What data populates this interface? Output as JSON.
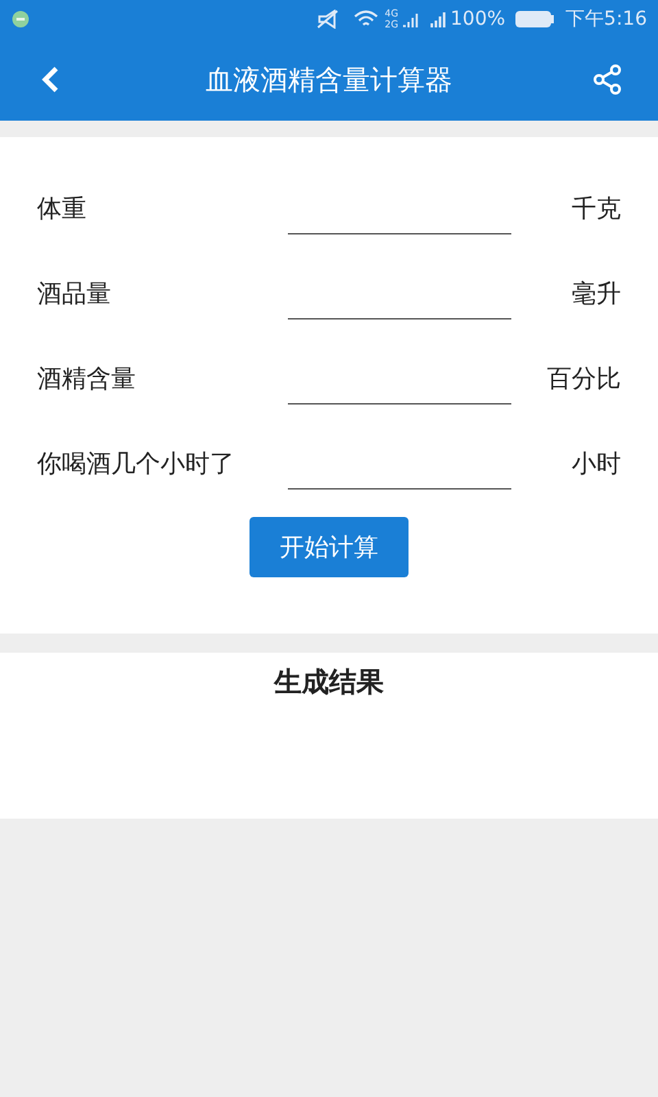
{
  "status_bar": {
    "network_top": "4G",
    "network_bottom": "2G",
    "battery_text": "100%",
    "time": "下午5:16"
  },
  "app_bar": {
    "title": "血液酒精含量计算器"
  },
  "form": {
    "fields": [
      {
        "label": "体重",
        "unit": "千克"
      },
      {
        "label": "酒品量",
        "unit": "毫升"
      },
      {
        "label": "酒精含量",
        "unit": "百分比"
      },
      {
        "label": "你喝酒几个小时了",
        "unit": "小时"
      }
    ],
    "button": "开始计算"
  },
  "result": {
    "title": "生成结果"
  }
}
